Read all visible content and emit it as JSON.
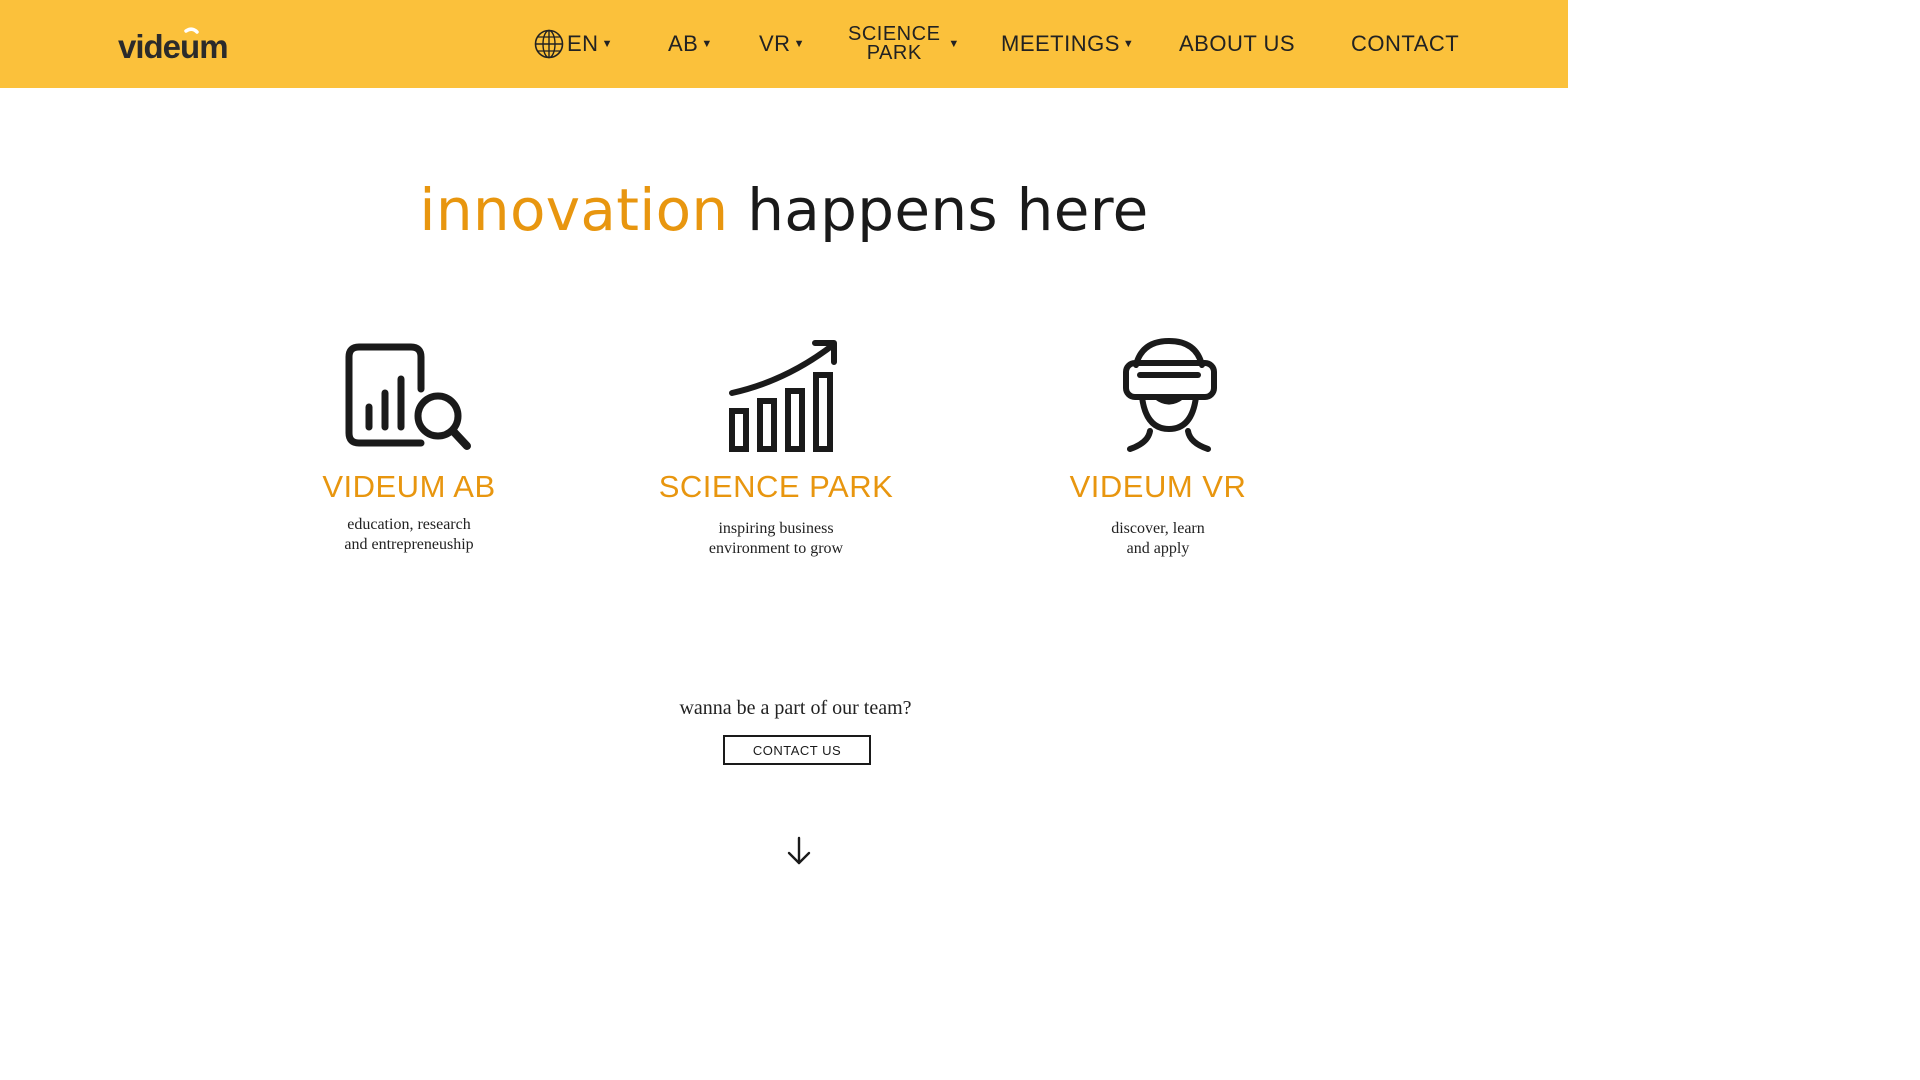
{
  "brand": {
    "logo_text": "videum",
    "accent_color": "#e8960f",
    "header_color": "#fbc13b"
  },
  "nav": {
    "language": {
      "label": "EN",
      "icon": "globe-icon"
    },
    "items": [
      {
        "label": "AB",
        "has_dropdown": true
      },
      {
        "label": "VR",
        "has_dropdown": true
      },
      {
        "label_line1": "SCIENCE",
        "label_line2": "PARK",
        "has_dropdown": true
      },
      {
        "label": "MEETINGS",
        "has_dropdown": true
      },
      {
        "label": "ABOUT US",
        "has_dropdown": false
      },
      {
        "label": "CONTACT",
        "has_dropdown": false
      }
    ]
  },
  "hero": {
    "accent_word": "innovation",
    "rest": "happens here"
  },
  "cards": [
    {
      "title": "VIDEUM AB",
      "desc_line1": "education, research",
      "desc_line2": "and entrepreneuship",
      "icon": "analytics-search-icon"
    },
    {
      "title": "SCIENCE PARK",
      "desc_line1": "inspiring business",
      "desc_line2": "environment to grow",
      "icon": "growth-chart-icon"
    },
    {
      "title": "VIDEUM VR",
      "desc_line1": "discover, learn",
      "desc_line2": "and apply",
      "icon": "vr-headset-icon"
    }
  ],
  "cta": {
    "question": "wanna be a part of our team?",
    "button_label": "CONTACT US"
  },
  "scroll": {
    "icon": "arrow-down-icon"
  }
}
